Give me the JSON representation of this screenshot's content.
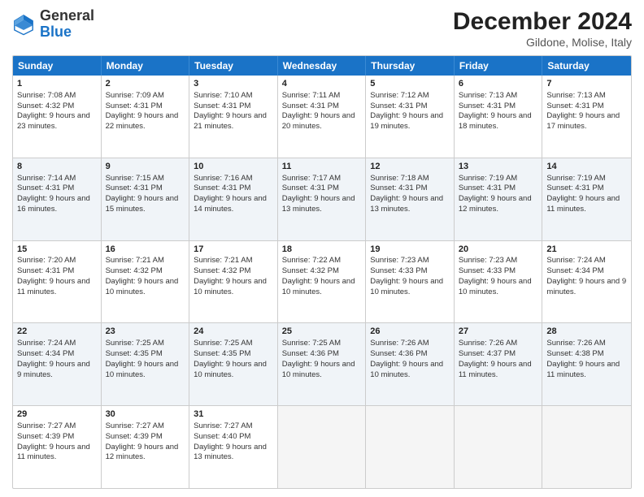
{
  "logo": {
    "line1": "General",
    "line2": "Blue"
  },
  "title": "December 2024",
  "subtitle": "Gildone, Molise, Italy",
  "days": [
    "Sunday",
    "Monday",
    "Tuesday",
    "Wednesday",
    "Thursday",
    "Friday",
    "Saturday"
  ],
  "weeks": [
    [
      {
        "day": 1,
        "sun": "7:08 AM",
        "set": "4:32 PM",
        "dl": "9 hours and 23 minutes."
      },
      {
        "day": 2,
        "sun": "7:09 AM",
        "set": "4:31 PM",
        "dl": "9 hours and 22 minutes."
      },
      {
        "day": 3,
        "sun": "7:10 AM",
        "set": "4:31 PM",
        "dl": "9 hours and 21 minutes."
      },
      {
        "day": 4,
        "sun": "7:11 AM",
        "set": "4:31 PM",
        "dl": "9 hours and 20 minutes."
      },
      {
        "day": 5,
        "sun": "7:12 AM",
        "set": "4:31 PM",
        "dl": "9 hours and 19 minutes."
      },
      {
        "day": 6,
        "sun": "7:13 AM",
        "set": "4:31 PM",
        "dl": "9 hours and 18 minutes."
      },
      {
        "day": 7,
        "sun": "7:13 AM",
        "set": "4:31 PM",
        "dl": "9 hours and 17 minutes."
      }
    ],
    [
      {
        "day": 8,
        "sun": "7:14 AM",
        "set": "4:31 PM",
        "dl": "9 hours and 16 minutes."
      },
      {
        "day": 9,
        "sun": "7:15 AM",
        "set": "4:31 PM",
        "dl": "9 hours and 15 minutes."
      },
      {
        "day": 10,
        "sun": "7:16 AM",
        "set": "4:31 PM",
        "dl": "9 hours and 14 minutes."
      },
      {
        "day": 11,
        "sun": "7:17 AM",
        "set": "4:31 PM",
        "dl": "9 hours and 13 minutes."
      },
      {
        "day": 12,
        "sun": "7:18 AM",
        "set": "4:31 PM",
        "dl": "9 hours and 13 minutes."
      },
      {
        "day": 13,
        "sun": "7:19 AM",
        "set": "4:31 PM",
        "dl": "9 hours and 12 minutes."
      },
      {
        "day": 14,
        "sun": "7:19 AM",
        "set": "4:31 PM",
        "dl": "9 hours and 11 minutes."
      }
    ],
    [
      {
        "day": 15,
        "sun": "7:20 AM",
        "set": "4:31 PM",
        "dl": "9 hours and 11 minutes."
      },
      {
        "day": 16,
        "sun": "7:21 AM",
        "set": "4:32 PM",
        "dl": "9 hours and 10 minutes."
      },
      {
        "day": 17,
        "sun": "7:21 AM",
        "set": "4:32 PM",
        "dl": "9 hours and 10 minutes."
      },
      {
        "day": 18,
        "sun": "7:22 AM",
        "set": "4:32 PM",
        "dl": "9 hours and 10 minutes."
      },
      {
        "day": 19,
        "sun": "7:23 AM",
        "set": "4:33 PM",
        "dl": "9 hours and 10 minutes."
      },
      {
        "day": 20,
        "sun": "7:23 AM",
        "set": "4:33 PM",
        "dl": "9 hours and 10 minutes."
      },
      {
        "day": 21,
        "sun": "7:24 AM",
        "set": "4:34 PM",
        "dl": "9 hours and 9 minutes."
      }
    ],
    [
      {
        "day": 22,
        "sun": "7:24 AM",
        "set": "4:34 PM",
        "dl": "9 hours and 9 minutes."
      },
      {
        "day": 23,
        "sun": "7:25 AM",
        "set": "4:35 PM",
        "dl": "9 hours and 10 minutes."
      },
      {
        "day": 24,
        "sun": "7:25 AM",
        "set": "4:35 PM",
        "dl": "9 hours and 10 minutes."
      },
      {
        "day": 25,
        "sun": "7:25 AM",
        "set": "4:36 PM",
        "dl": "9 hours and 10 minutes."
      },
      {
        "day": 26,
        "sun": "7:26 AM",
        "set": "4:36 PM",
        "dl": "9 hours and 10 minutes."
      },
      {
        "day": 27,
        "sun": "7:26 AM",
        "set": "4:37 PM",
        "dl": "9 hours and 11 minutes."
      },
      {
        "day": 28,
        "sun": "7:26 AM",
        "set": "4:38 PM",
        "dl": "9 hours and 11 minutes."
      }
    ],
    [
      {
        "day": 29,
        "sun": "7:27 AM",
        "set": "4:39 PM",
        "dl": "9 hours and 11 minutes."
      },
      {
        "day": 30,
        "sun": "7:27 AM",
        "set": "4:39 PM",
        "dl": "9 hours and 12 minutes."
      },
      {
        "day": 31,
        "sun": "7:27 AM",
        "set": "4:40 PM",
        "dl": "9 hours and 13 minutes."
      },
      null,
      null,
      null,
      null
    ]
  ]
}
